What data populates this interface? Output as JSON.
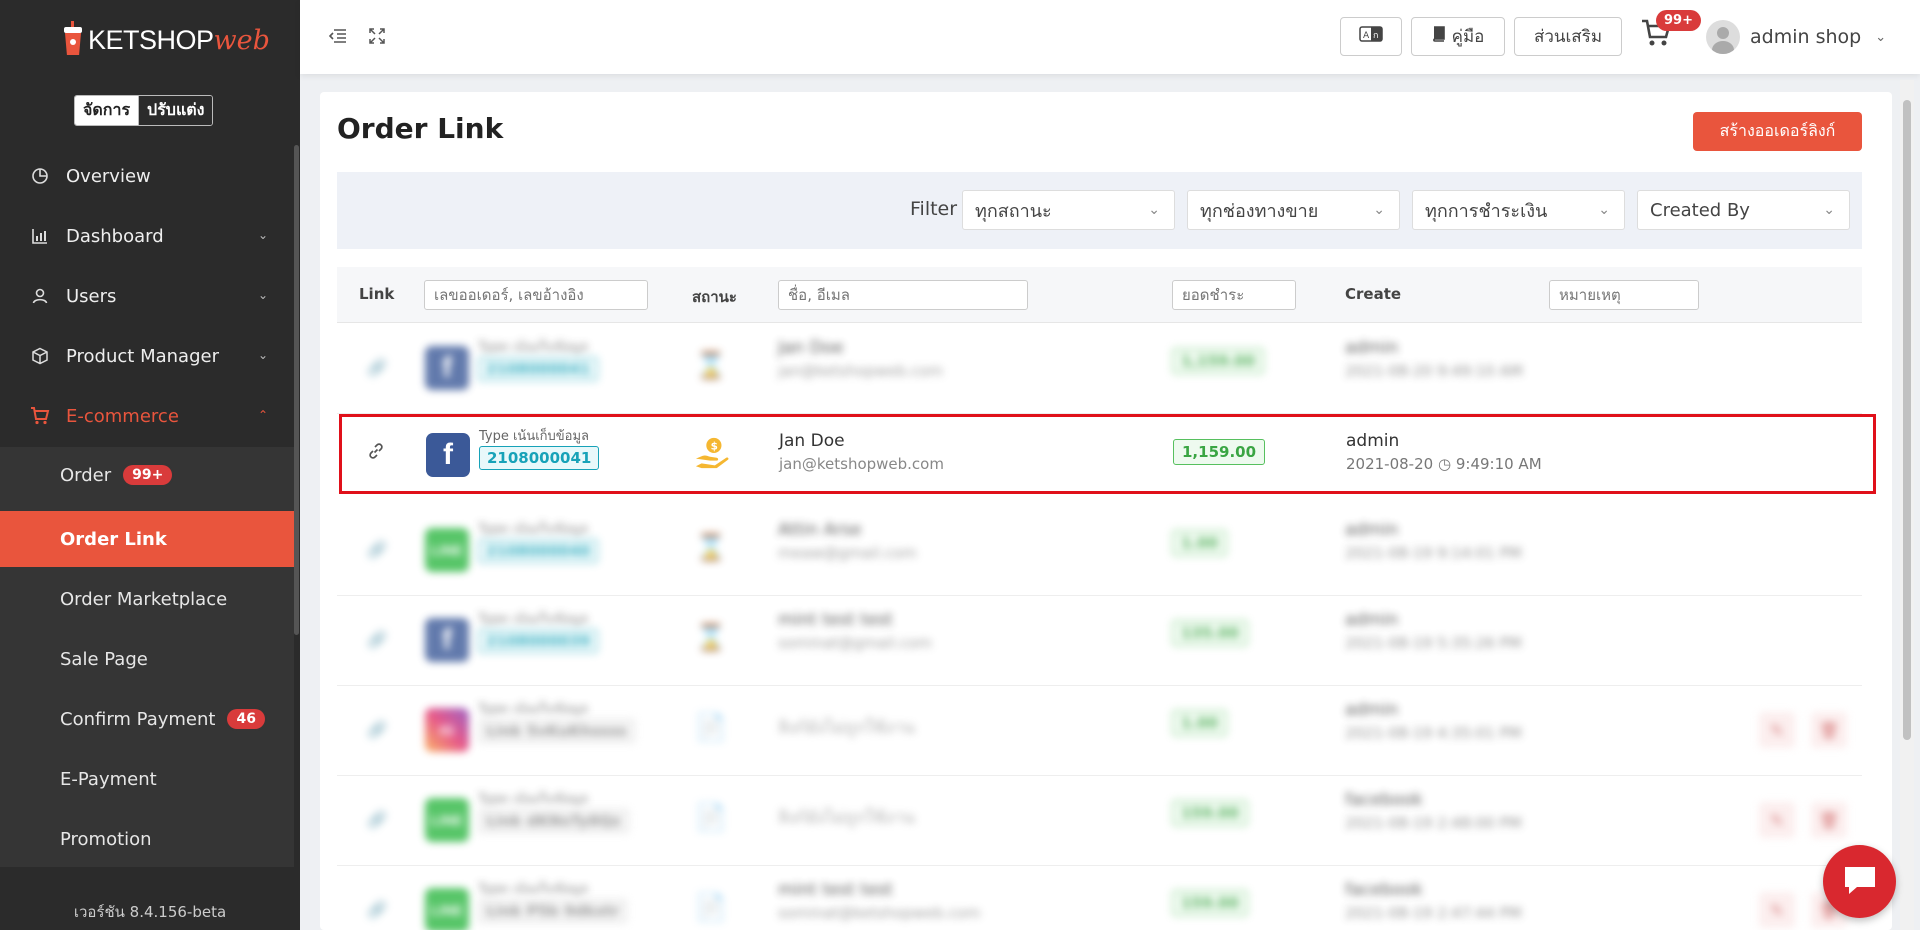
{
  "brand": {
    "name": "KETSHOP",
    "suffix": "web",
    "accent": "#e9553d"
  },
  "mode_toggle": {
    "manage": "จัดการ",
    "customize": "ปรับแต่ง"
  },
  "sidebar": {
    "items": [
      {
        "label": "Overview",
        "icon": "pie-chart-icon"
      },
      {
        "label": "Dashboard",
        "icon": "bar-chart-icon"
      },
      {
        "label": "Users",
        "icon": "user-icon"
      },
      {
        "label": "Product Manager",
        "icon": "box-icon"
      },
      {
        "label": "E-commerce",
        "icon": "cart-icon"
      }
    ],
    "submenu": [
      {
        "label": "Order",
        "badge": "99+"
      },
      {
        "label": "Order Link"
      },
      {
        "label": "Order Marketplace"
      },
      {
        "label": "Sale Page"
      },
      {
        "label": "Confirm Payment",
        "badge": "46"
      },
      {
        "label": "E-Payment"
      },
      {
        "label": "Promotion"
      }
    ],
    "version": "เวอร์ชัน 8.4.156-beta"
  },
  "topbar": {
    "manual": "คู่มือ",
    "addons": "ส่วนเสริม",
    "cart_badge": "99+",
    "user": "admin shop"
  },
  "page": {
    "title": "Order Link",
    "create_button": "สร้างออเดอร์ลิงก์"
  },
  "filters": {
    "label": "Filter",
    "status": "ทุกสถานะ",
    "channel": "ทุกช่องทางขาย",
    "payment": "ทุกการชำระเงิน",
    "created_by": "Created By"
  },
  "table": {
    "headers": {
      "link": "Link",
      "status": "สถานะ",
      "create": "Create"
    },
    "placeholders": {
      "order": "เลขออเดอร์, เลขอ้างอิง",
      "customer": "ชื่อ, อีเมล",
      "amount": "ยอดชำระ",
      "note": "หมายเหตุ"
    },
    "rows": [
      {
        "channel": "facebook",
        "type_label": "Type เน้นเก็บข้อมูล",
        "order_no": "2108000041",
        "customer": "Jan Doe",
        "email": "jan@ketshopweb.com",
        "amount": "1,159.00",
        "creator": "admin",
        "created_at": "2021-08-20",
        "created_time": "9:49:10 AM",
        "blurred": true
      },
      {
        "channel": "facebook",
        "type_label": "Type เน้นเก็บข้อมูล",
        "order_no": "2108000041",
        "customer": "Jan Doe",
        "email": "jan@ketshopweb.com",
        "amount": "1,159.00",
        "creator": "admin",
        "created_at": "2021-08-20",
        "created_time": "9:49:10 AM",
        "blurred": false
      },
      {
        "channel": "line",
        "type_label": "Type เน้นเก็บข้อมูล",
        "order_no": "2108000040",
        "customer": "Attin Arse",
        "email": "meaw@gmail.com",
        "amount": "1.00",
        "creator": "admin",
        "created_at": "2021-08-19",
        "created_time": "9:14:01 PM",
        "blurred": true
      },
      {
        "channel": "facebook",
        "type_label": "Type เน้นเก็บข้อมูล",
        "order_no": "2108000039",
        "customer": "mint test test",
        "email": "sominat@gmail.com",
        "amount": "135.00",
        "creator": "admin",
        "created_at": "2021-08-19",
        "created_time": "5:35:26 PM",
        "blurred": true
      },
      {
        "channel": "instagram",
        "type_label": "Type เน้นเก็บข้อมูล",
        "order_no": "Link 5vKuKhssss",
        "customer": "ลิงก์ยังไม่ถูกใช้งาน",
        "email": "",
        "amount": "1.00",
        "creator": "admin",
        "created_at": "2021-08-19",
        "created_time": "4:35:01 PM",
        "blurred": true
      },
      {
        "channel": "line",
        "type_label": "Type เน้นเก็บข้อมูล",
        "order_no": "Link dKNsTy8Qz",
        "customer": "ลิงก์ยังไม่ถูกใช้งาน",
        "email": "",
        "amount": "159.00",
        "creator": "facebook",
        "created_at": "2021-08-19",
        "created_time": "2:48:00 PM",
        "blurred": true
      },
      {
        "channel": "line",
        "type_label": "Type เน้นเก็บข้อมูล",
        "order_no": "Link P5b 9dkxtr",
        "customer": "mint test test",
        "email": "sominat@ketshopweb.com",
        "amount": "159.00",
        "creator": "facebook",
        "created_at": "2021-08-19",
        "created_time": "2:47:44 PM",
        "blurred": true
      }
    ]
  }
}
